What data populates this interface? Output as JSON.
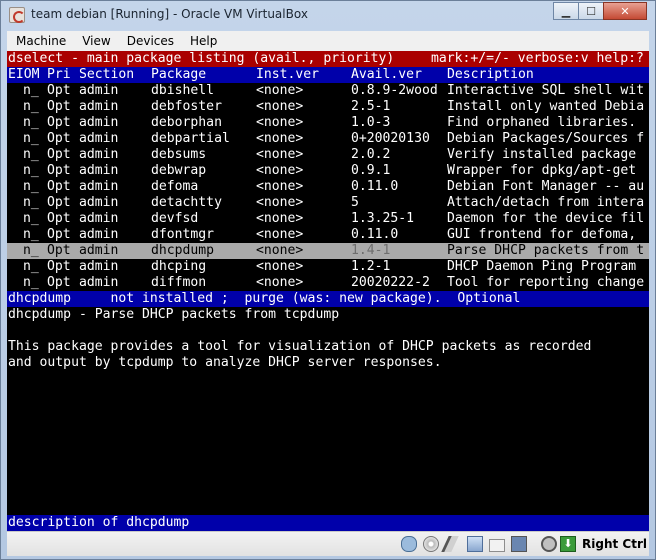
{
  "window": {
    "title": "team debian [Running] - Oracle VM VirtualBox"
  },
  "menubar": {
    "items": [
      "Machine",
      "View",
      "Devices",
      "Help"
    ]
  },
  "colors": {
    "header_bg": "#aa0000",
    "header_fg": "#ffffff",
    "table_head_bg": "#0000aa",
    "table_head_fg": "#ffffff",
    "row_fg": "#ffffff",
    "highlight_bg": "#aaaaaa",
    "highlight_fg": "#000000",
    "status_bg": "#0000aa",
    "status_fg": "#ffffff",
    "desc_fg": "#ffffff"
  },
  "terminal": {
    "header_left": "dselect - main package listing (avail., priority)",
    "header_right": "mark:+/=/- verbose:v help:?",
    "columns": [
      "EIOM",
      "Pri",
      "Section",
      "Package",
      "Inst.ver",
      "Avail.ver",
      "Description"
    ],
    "rows": [
      {
        "eiom": "n_",
        "pri": "Opt",
        "section": "admin",
        "package": "dbishell",
        "inst": "<none>",
        "avail": "0.8.9-2wood",
        "desc": "Interactive SQL shell wit"
      },
      {
        "eiom": "n_",
        "pri": "Opt",
        "section": "admin",
        "package": "debfoster",
        "inst": "<none>",
        "avail": "2.5-1",
        "desc": "Install only wanted Debia"
      },
      {
        "eiom": "n_",
        "pri": "Opt",
        "section": "admin",
        "package": "deborphan",
        "inst": "<none>",
        "avail": "1.0-3",
        "desc": "Find orphaned libraries."
      },
      {
        "eiom": "n_",
        "pri": "Opt",
        "section": "admin",
        "package": "debpartial",
        "inst": "<none>",
        "avail": "0+20020130",
        "desc": "Debian Packages/Sources f"
      },
      {
        "eiom": "n_",
        "pri": "Opt",
        "section": "admin",
        "package": "debsums",
        "inst": "<none>",
        "avail": "2.0.2",
        "desc": "Verify installed package"
      },
      {
        "eiom": "n_",
        "pri": "Opt",
        "section": "admin",
        "package": "debwrap",
        "inst": "<none>",
        "avail": "0.9.1",
        "desc": "Wrapper for dpkg/apt-get"
      },
      {
        "eiom": "n_",
        "pri": "Opt",
        "section": "admin",
        "package": "defoma",
        "inst": "<none>",
        "avail": "0.11.0",
        "desc": "Debian Font Manager -- au"
      },
      {
        "eiom": "n_",
        "pri": "Opt",
        "section": "admin",
        "package": "detachtty",
        "inst": "<none>",
        "avail": "5",
        "desc": "Attach/detach from intera"
      },
      {
        "eiom": "n_",
        "pri": "Opt",
        "section": "admin",
        "package": "devfsd",
        "inst": "<none>",
        "avail": "1.3.25-1",
        "desc": "Daemon for the device fil"
      },
      {
        "eiom": "n_",
        "pri": "Opt",
        "section": "admin",
        "package": "dfontmgr",
        "inst": "<none>",
        "avail": "0.11.0",
        "desc": "GUI frontend for defoma,"
      },
      {
        "eiom": "n_",
        "pri": "Opt",
        "section": "admin",
        "package": "dhcpdump",
        "inst": "<none>",
        "avail": "1.4-1",
        "desc": "Parse DHCP packets from t",
        "selected": true
      },
      {
        "eiom": "n_",
        "pri": "Opt",
        "section": "admin",
        "package": "dhcping",
        "inst": "<none>",
        "avail": "1.2-1",
        "desc": "DHCP Daemon Ping Program"
      },
      {
        "eiom": "n_",
        "pri": "Opt",
        "section": "admin",
        "package": "diffmon",
        "inst": "<none>",
        "avail": "20020222-2",
        "desc": "Tool for reporting change"
      }
    ],
    "status_line": "dhcpdump     not installed ;  purge (was: new package).  Optional",
    "desc_title": "dhcpdump - Parse DHCP packets from tcpdump",
    "desc_body": [
      "This package provides a tool for visualization of DHCP packets as recorded",
      "and output by tcpdump to analyze DHCP server responses."
    ],
    "bottom_line": "description of dhcpdump"
  },
  "statusbar": {
    "icons": [
      "hard-disk-icon",
      "optical-drive-icon",
      "usb-icon",
      "network-icon",
      "shared-folder-icon",
      "display-icon",
      "capture-icon",
      "mouse-integration-icon"
    ],
    "host_key_icon": "keyboard-arrow-icon",
    "host_key": "Right Ctrl"
  }
}
